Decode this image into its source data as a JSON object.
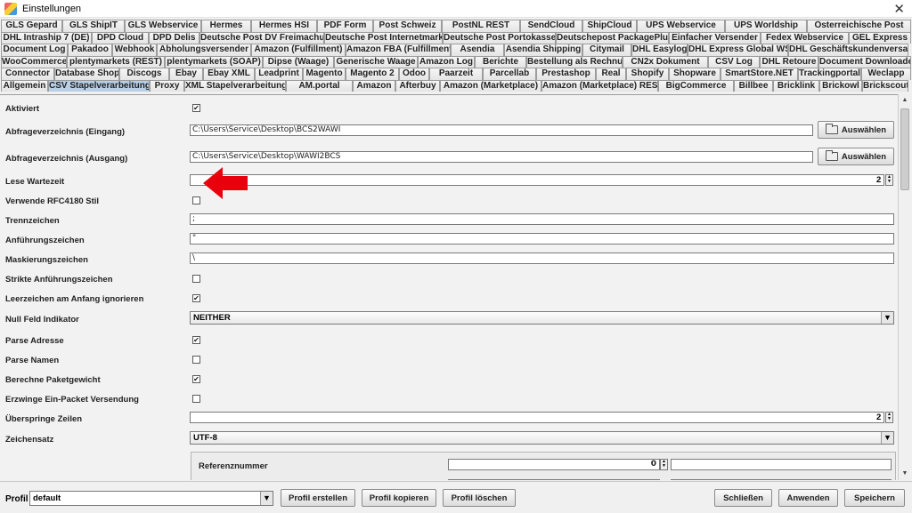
{
  "window": {
    "title": "Einstellungen",
    "close_glyph": "✕"
  },
  "tabs": {
    "row1": [
      "GLS Gepard",
      "GLS ShipIT",
      "GLS Webservice",
      "Hermes",
      "Hermes HSI",
      "PDF Form",
      "Post Schweiz",
      "PostNL REST",
      "SendCloud",
      "ShipCloud",
      "UPS Webservice",
      "UPS Worldship",
      "Österreichische Post"
    ],
    "row2": [
      "DHL Intraship 7 (DE)",
      "DPD Cloud",
      "DPD Delis",
      "Deutsche Post DV Freimachung",
      "Deutsche Post Internetmarke",
      "Deutsche Post Portokasse",
      "Deutschepost PackagePlus",
      "Einfacher Versender",
      "Fedex Webservice",
      "GEL Express"
    ],
    "row3": [
      "Document Log",
      "Pakadoo",
      "Webhook",
      "Abholungsversender",
      "Amazon (Fulfillment)",
      "Amazon FBA (Fulfillment)",
      "Asendia",
      "Asendia Shipping",
      "Citymail",
      "DHL Easylog",
      "DHL Express Global WS",
      "DHL Geschäftskundenversand"
    ],
    "row4": [
      "WooCommerce",
      "plentymarkets (REST)",
      "plentymarkets (SOAP)",
      "Dipse (Waage)",
      "Generische Waage",
      "Amazon Log",
      "Berichte",
      "Bestellung als Rechnung",
      "CN2x Dokument",
      "CSV Log",
      "DHL Retoure",
      "Document Downloader"
    ],
    "row5": [
      "Connector",
      "Database Shop",
      "Discogs",
      "Ebay",
      "Ebay XML",
      "Leadprint",
      "Magento",
      "Magento 2",
      "Odoo",
      "Paarzeit",
      "Parcellab",
      "Prestashop",
      "Real",
      "Shopify",
      "Shopware",
      "SmartStore.NET",
      "Trackingportal",
      "Weclapp"
    ],
    "row6": [
      "Allgemein",
      "CSV Stapelverarbeitung",
      "Proxy",
      "XML Stapelverarbeitung",
      "AM.portal",
      "Amazon",
      "Afterbuy",
      "Amazon (Marketplace)",
      "Amazon (Marketplace) REST",
      "BigCommerce",
      "Billbee",
      "Bricklink",
      "Brickowl",
      "Brickscout"
    ],
    "active": "CSV Stapelverarbeitung"
  },
  "settings": {
    "aktiviert": {
      "label": "Aktiviert",
      "checked": true
    },
    "eingang": {
      "label": "Abfrageverzeichnis (Eingang)",
      "value": "C:\\Users\\Service\\Desktop\\BCS2WAWI"
    },
    "ausgang": {
      "label": "Abfrageverzeichnis (Ausgang)",
      "value": "C:\\Users\\Service\\Desktop\\WAWI2BCS"
    },
    "auswaehlen_label": "Auswählen",
    "lese_wartezeit": {
      "label": "Lese Wartezeit",
      "value": "2"
    },
    "rfc4180": {
      "label": "Verwende RFC4180 Stil",
      "checked": false
    },
    "trennzeichen": {
      "label": "Trennzeichen",
      "value": ";"
    },
    "anfuehrungszeichen": {
      "label": "Anführungszeichen",
      "value": "\""
    },
    "maskierungszeichen": {
      "label": "Maskierungszeichen",
      "value": "\\"
    },
    "strikte": {
      "label": "Strikte Anführungszeichen",
      "checked": false
    },
    "leerzeichen": {
      "label": "Leerzeichen am Anfang ignorieren",
      "checked": true
    },
    "null_feld": {
      "label": "Null Feld Indikator",
      "value": "NEITHER"
    },
    "parse_adresse": {
      "label": "Parse Adresse",
      "checked": true
    },
    "parse_namen": {
      "label": "Parse Namen",
      "checked": false
    },
    "berechne": {
      "label": "Berechne Paketgewicht",
      "checked": true
    },
    "erzwinge": {
      "label": "Erzwinge Ein-Packet Versendung",
      "checked": false
    },
    "ueberspringe": {
      "label": "Überspringe Zeilen",
      "value": "2"
    },
    "zeichensatz": {
      "label": "Zeichensatz",
      "value": "UTF-8"
    },
    "referenznummer": {
      "label": "Referenznummer",
      "value": "0"
    }
  },
  "bottom": {
    "profil_label": "Profil",
    "profil_value": "default",
    "profil_erstellen": "Profil erstellen",
    "profil_kopieren": "Profil kopieren",
    "profil_loeschen": "Profil löschen",
    "schliessen": "Schließen",
    "anwenden": "Anwenden",
    "speichern": "Speichern"
  },
  "colors": {
    "active_tab": "#b8cfe5",
    "annotation_arrow": "#e8000d"
  }
}
